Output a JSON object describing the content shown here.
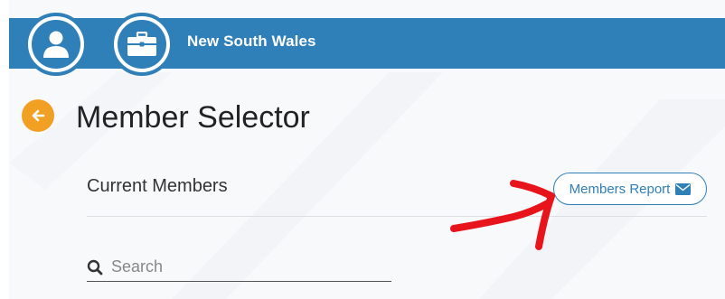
{
  "header": {
    "title": "New South Wales"
  },
  "icons": {
    "user": "user-icon",
    "briefcase": "briefcase-icon",
    "back": "back-arrow-icon",
    "search": "search-icon",
    "envelope": "envelope-icon"
  },
  "page": {
    "title": "Member Selector"
  },
  "members": {
    "section_title": "Current Members",
    "report_button_label": "Members Report"
  },
  "search": {
    "placeholder": "Search"
  },
  "colors": {
    "brand_blue": "#2f7fb8",
    "back_orange": "#f2a024",
    "annotation_red": "#e8141b"
  }
}
